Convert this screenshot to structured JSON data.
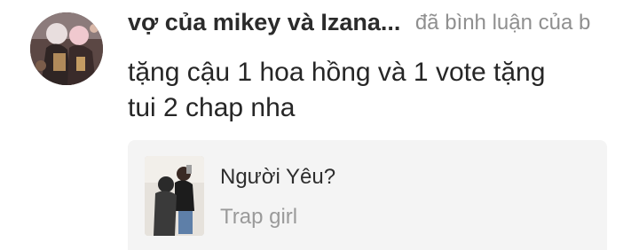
{
  "comment": {
    "avatar_icon": "user-avatar-anime-icon",
    "username": "vợ của mikey và Izana...",
    "action_text": "đã bình luận của b",
    "text": "tặng cậu 1 hoa hồng và 1 vote tặng\ntui 2 chap nha"
  },
  "story": {
    "cover_icon": "story-cover-image",
    "title": "Người Yêu?",
    "author": "Trap girl"
  },
  "colors": {
    "username": "#2b2b2b",
    "action": "#8f8f8f",
    "card_background": "#f4f4f4",
    "author": "#9a9a9a"
  }
}
